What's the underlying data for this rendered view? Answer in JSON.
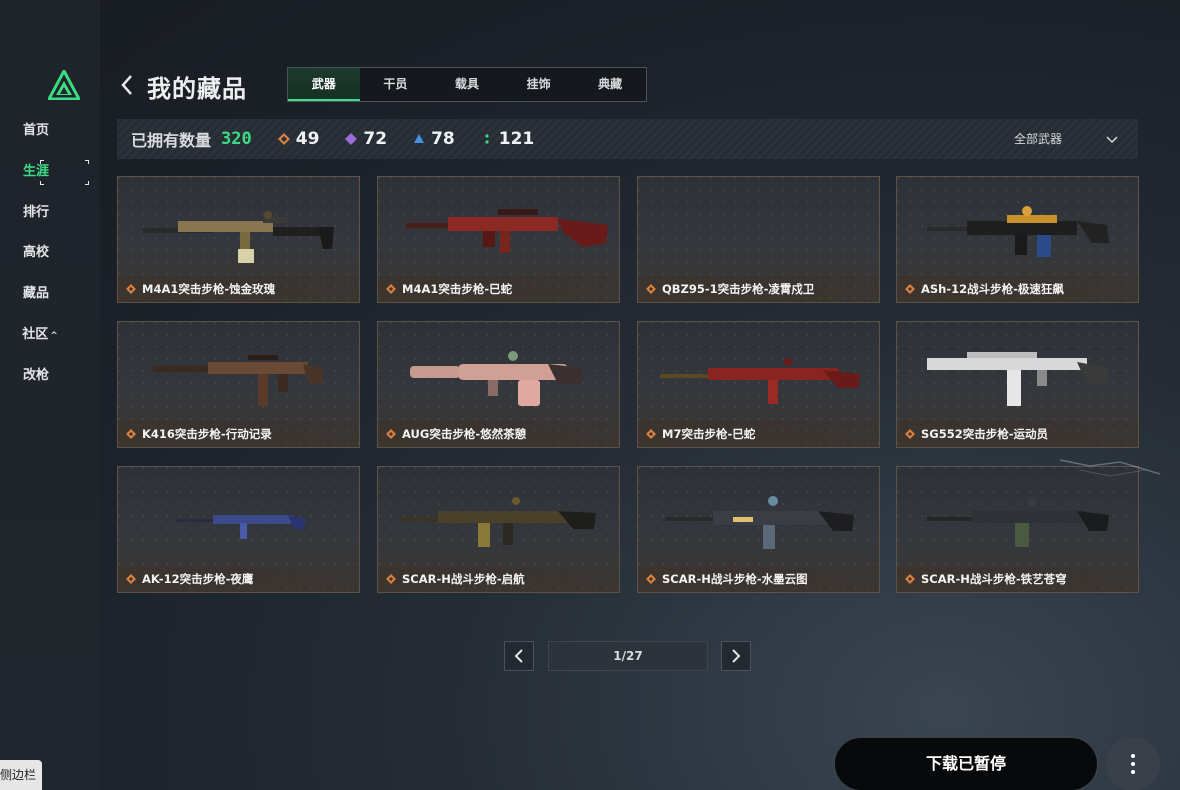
{
  "sidebar": {
    "items": [
      {
        "label": "首页",
        "active": false
      },
      {
        "label": "生涯",
        "active": true
      },
      {
        "label": "排行",
        "active": false
      },
      {
        "label": "高校",
        "active": false
      },
      {
        "label": "藏品",
        "active": false
      },
      {
        "label": "社区",
        "active": false,
        "chevron": "^"
      },
      {
        "label": "改枪",
        "active": false
      }
    ],
    "toggle_label": "侧边栏"
  },
  "header": {
    "title": "我的藏品",
    "tabs": [
      {
        "label": "武器",
        "active": true
      },
      {
        "label": "干员",
        "active": false
      },
      {
        "label": "载具",
        "active": false
      },
      {
        "label": "挂饰",
        "active": false
      },
      {
        "label": "典藏",
        "active": false
      }
    ]
  },
  "summary": {
    "owned_label": "已拥有数量",
    "owned_total": "320",
    "stats": [
      {
        "value": "49",
        "color": "#d9803f",
        "icon": "diamond-icon"
      },
      {
        "value": "72",
        "color": "#9b6bd9",
        "icon": "purple-diamond-icon"
      },
      {
        "value": "78",
        "color": "#4a90e2",
        "icon": "blue-shape-icon"
      },
      {
        "value": "121",
        "color": "#3ddc84",
        "icon": "green-dots-icon"
      }
    ],
    "filter_label": "全部武器"
  },
  "colors": {
    "accent": "#3ddc84",
    "rarity_orange": "#d9803f"
  },
  "cards": [
    {
      "name": "M4A1突击步枪-蚀金玫瑰"
    },
    {
      "name": "M4A1突击步枪-巳蛇"
    },
    {
      "name": "QBZ95-1突击步枪-凌霄戍卫"
    },
    {
      "name": "ASh-12战斗步枪-极速狂飙"
    },
    {
      "name": "K416突击步枪-行动记录"
    },
    {
      "name": "AUG突击步枪-悠然茶憩"
    },
    {
      "name": "M7突击步枪-巳蛇"
    },
    {
      "name": "SG552突击步枪-运动员"
    },
    {
      "name": "AK-12突击步枪-夜鹰"
    },
    {
      "name": "SCAR-H战斗步枪-启航"
    },
    {
      "name": "SCAR-H战斗步枪-水墨云图"
    },
    {
      "name": "SCAR-H战斗步枪-铁艺苍穹"
    }
  ],
  "pagination": {
    "text": "1/27"
  },
  "actions": {
    "download_label": "下载已暂停"
  }
}
